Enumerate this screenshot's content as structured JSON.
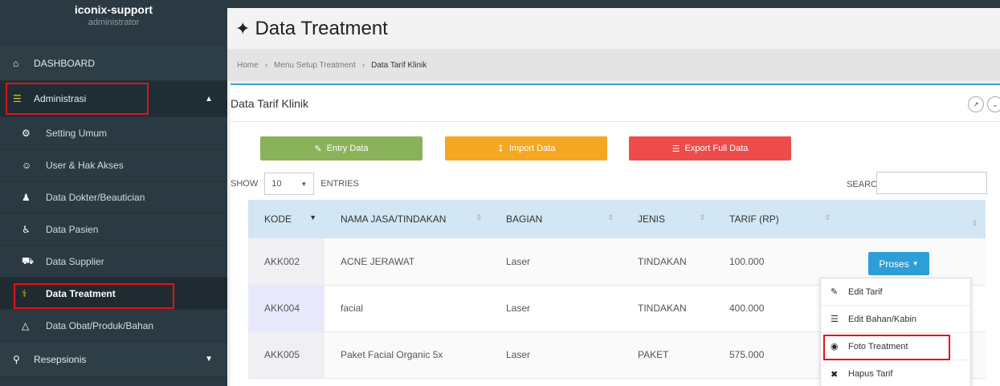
{
  "user": {
    "name": "iconix-support",
    "role": "administrator"
  },
  "sidebar": {
    "dashboard": {
      "label": "DASHBOARD",
      "icon": "home-icon"
    },
    "administrasi": {
      "label": "Administrasi",
      "icon": "folder-icon"
    },
    "subitems": [
      {
        "label": "Setting Umum",
        "icon": "gear-icon"
      },
      {
        "label": "User & Hak Akses",
        "icon": "smiley-icon"
      },
      {
        "label": "Data Dokter/Beautician",
        "icon": "users-icon"
      },
      {
        "label": "Data Pasien",
        "icon": "wheelchair-icon"
      },
      {
        "label": "Data Supplier",
        "icon": "truck-icon"
      },
      {
        "label": "Data Treatment",
        "icon": "stethoscope-icon"
      },
      {
        "label": "Data Obat/Produk/Bahan",
        "icon": "flask-icon"
      }
    ],
    "resepsionis": {
      "label": "Resepsionis",
      "icon": "chat-icon"
    }
  },
  "page": {
    "title": "Data Treatment"
  },
  "breadcrumb": {
    "home": "Home",
    "menu": "Menu Setup Treatment",
    "current": "Data Tarif Klinik",
    "sep": "›"
  },
  "panel": {
    "title": "Data Tarif Klinik"
  },
  "buttons": {
    "entry": "Entry Data",
    "import": "Import Data",
    "export": "Export Full Data"
  },
  "table_controls": {
    "show": "SHOW",
    "entries_value": "10",
    "entries": "ENTRIES",
    "search": "SEARCH:"
  },
  "table": {
    "headers": [
      "KODE",
      "NAMA JASA/TINDAKAN",
      "BAGIAN",
      "JENIS",
      "TARIF (RP)",
      ""
    ],
    "rows": [
      [
        "AKK002",
        "ACNE JERAWAT",
        "Laser",
        "TINDAKAN",
        "100.000"
      ],
      [
        "AKK004",
        "facial",
        "Laser",
        "TINDAKAN",
        "400.000"
      ],
      [
        "AKK005",
        "Paket Facial Organic 5x",
        "Laser",
        "PAKET",
        "575.000"
      ]
    ]
  },
  "proses": {
    "label": "Proses"
  },
  "dropdown": {
    "items": [
      {
        "label": "Edit Tarif",
        "icon": "pencil-icon"
      },
      {
        "label": "Edit Bahan/Kabin",
        "icon": "list-icon"
      },
      {
        "label": "Foto Treatment",
        "icon": "camera-icon"
      },
      {
        "label": "Hapus Tarif",
        "icon": "close-icon"
      }
    ]
  },
  "colors": {
    "sidebar": "#2b3a42",
    "highlight": "#e0141a",
    "accent": "#3aa4d6",
    "green": "#8ab25a",
    "orange": "#f5a623",
    "red": "#ee4b4b"
  }
}
